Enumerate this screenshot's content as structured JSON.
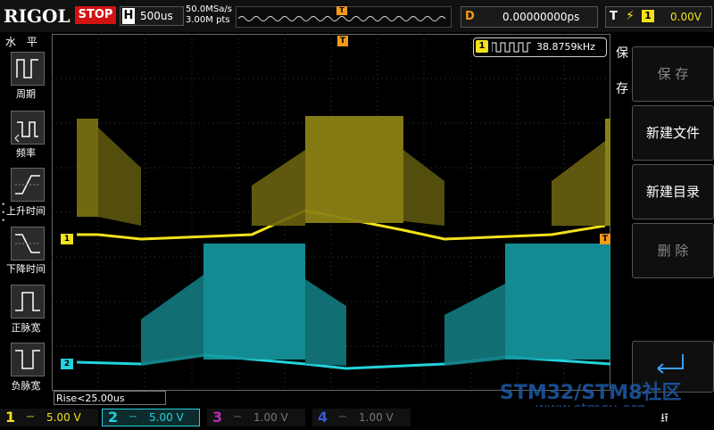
{
  "top": {
    "brand": "RIGOL",
    "run_state": "STOP",
    "timebase_label": "H",
    "timebase_value": "500us",
    "sample_rate": "50.0MSa/s",
    "mem_depth": "3.00M pts",
    "trigger_marker": "T",
    "delay_label": "D",
    "delay_value": "0.00000000ps",
    "trig_label": "T",
    "trig_source": "1",
    "trig_level": "0.00V"
  },
  "left_menu": {
    "title": "水 平",
    "items": [
      {
        "label": "周期"
      },
      {
        "label": "频率"
      },
      {
        "label": "上升时间"
      },
      {
        "label": "下降时间"
      },
      {
        "label": "正脉宽"
      },
      {
        "label": "负脉宽"
      }
    ]
  },
  "right_menu": {
    "title": "保存",
    "items": [
      {
        "label": "保 存",
        "enabled": false
      },
      {
        "label": "新建文件",
        "enabled": true
      },
      {
        "label": "新建目录",
        "enabled": true
      },
      {
        "label": "删 除",
        "enabled": false
      }
    ]
  },
  "measurement": {
    "channel": "1",
    "value": "38.8759kHz",
    "readout": "Rise<25.00us"
  },
  "channels": [
    {
      "num": "1",
      "scale": "5.00 V",
      "color": "#f2e21b",
      "active": true
    },
    {
      "num": "2",
      "scale": "5.00 V",
      "color": "#22d3de",
      "active": true
    },
    {
      "num": "3",
      "scale": "1.00 V",
      "color": "#b42fb4",
      "active": false
    },
    {
      "num": "4",
      "scale": "1.00 V",
      "color": "#3558d8",
      "active": false
    }
  ],
  "markers": {
    "ch1": "1",
    "ch2": "2",
    "trigger": "T"
  },
  "watermark": {
    "line1": "STM32/STM8社区",
    "line2": "www.stmcu.org"
  }
}
